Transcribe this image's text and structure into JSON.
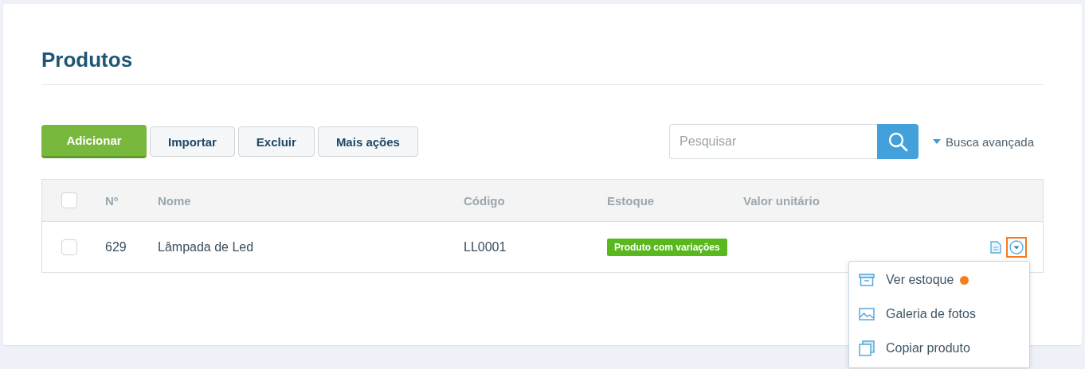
{
  "page": {
    "title": "Produtos"
  },
  "toolbar": {
    "buttons": [
      {
        "label": "Adicionar",
        "kind": "primary"
      },
      {
        "label": "Importar",
        "kind": "default"
      },
      {
        "label": "Excluir",
        "kind": "default"
      },
      {
        "label": "Mais ações",
        "kind": "default"
      }
    ],
    "search": {
      "placeholder": "Pesquisar"
    },
    "advanced_search": "Busca avançada"
  },
  "table": {
    "columns": [
      "Nº",
      "Nome",
      "Código",
      "Estoque",
      "Valor unitário"
    ],
    "header_checked": false,
    "rows": [
      {
        "checked": false,
        "number": "629",
        "name": "Lâmpada de Led",
        "code": "LL0001",
        "stock_tag": "Produto com variações",
        "menu_open": true
      }
    ]
  },
  "row_menu": {
    "items": [
      {
        "label": "Ver estoque",
        "kind": "stock",
        "notification": true
      },
      {
        "label": "Galeria de fotos",
        "kind": "gallery",
        "notification": false
      },
      {
        "label": "Copiar produto",
        "kind": "copy",
        "notification": false
      }
    ]
  }
}
